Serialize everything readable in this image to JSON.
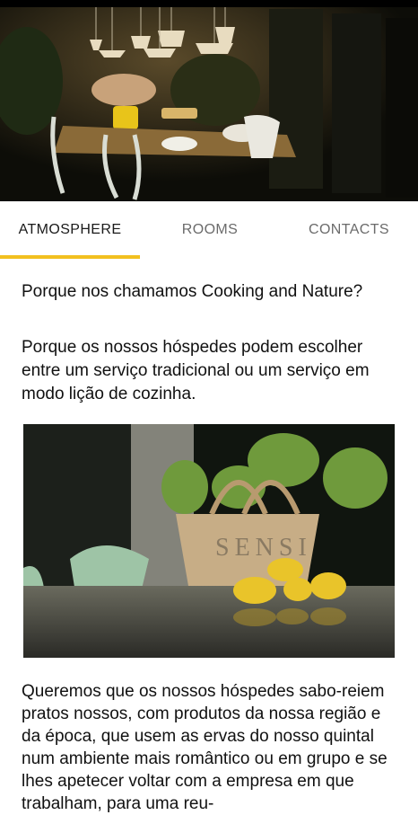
{
  "hero": {
    "image": "restaurant-interior-photo"
  },
  "tabs": [
    {
      "label": "ATMOSPHERE",
      "active": true
    },
    {
      "label": "ROOMS",
      "active": false
    },
    {
      "label": "CONTACTS",
      "active": false
    }
  ],
  "colors": {
    "accent": "#f2c01f",
    "text": "#111111",
    "tab_inactive": "#6b6b6b"
  },
  "content": {
    "heading_question": "Porque nos chamamos Cooking and Nature?",
    "paragraph_answer": "Porque os nossos hóspedes podem escolher entre um serviço tradicional ou um serviço em modo lição de cozinha.",
    "photo": {
      "image": "basket-lemons-photo",
      "basket_text": "SENSI"
    },
    "paragraph_body": "Queremos que os nossos hóspedes sabo-reiem pratos nossos, com produtos da nossa região e da época, que usem as ervas do nosso quintal num ambiente mais romântico ou em grupo e se lhes apetecer voltar com a empresa em que trabalham, para uma reu-"
  }
}
